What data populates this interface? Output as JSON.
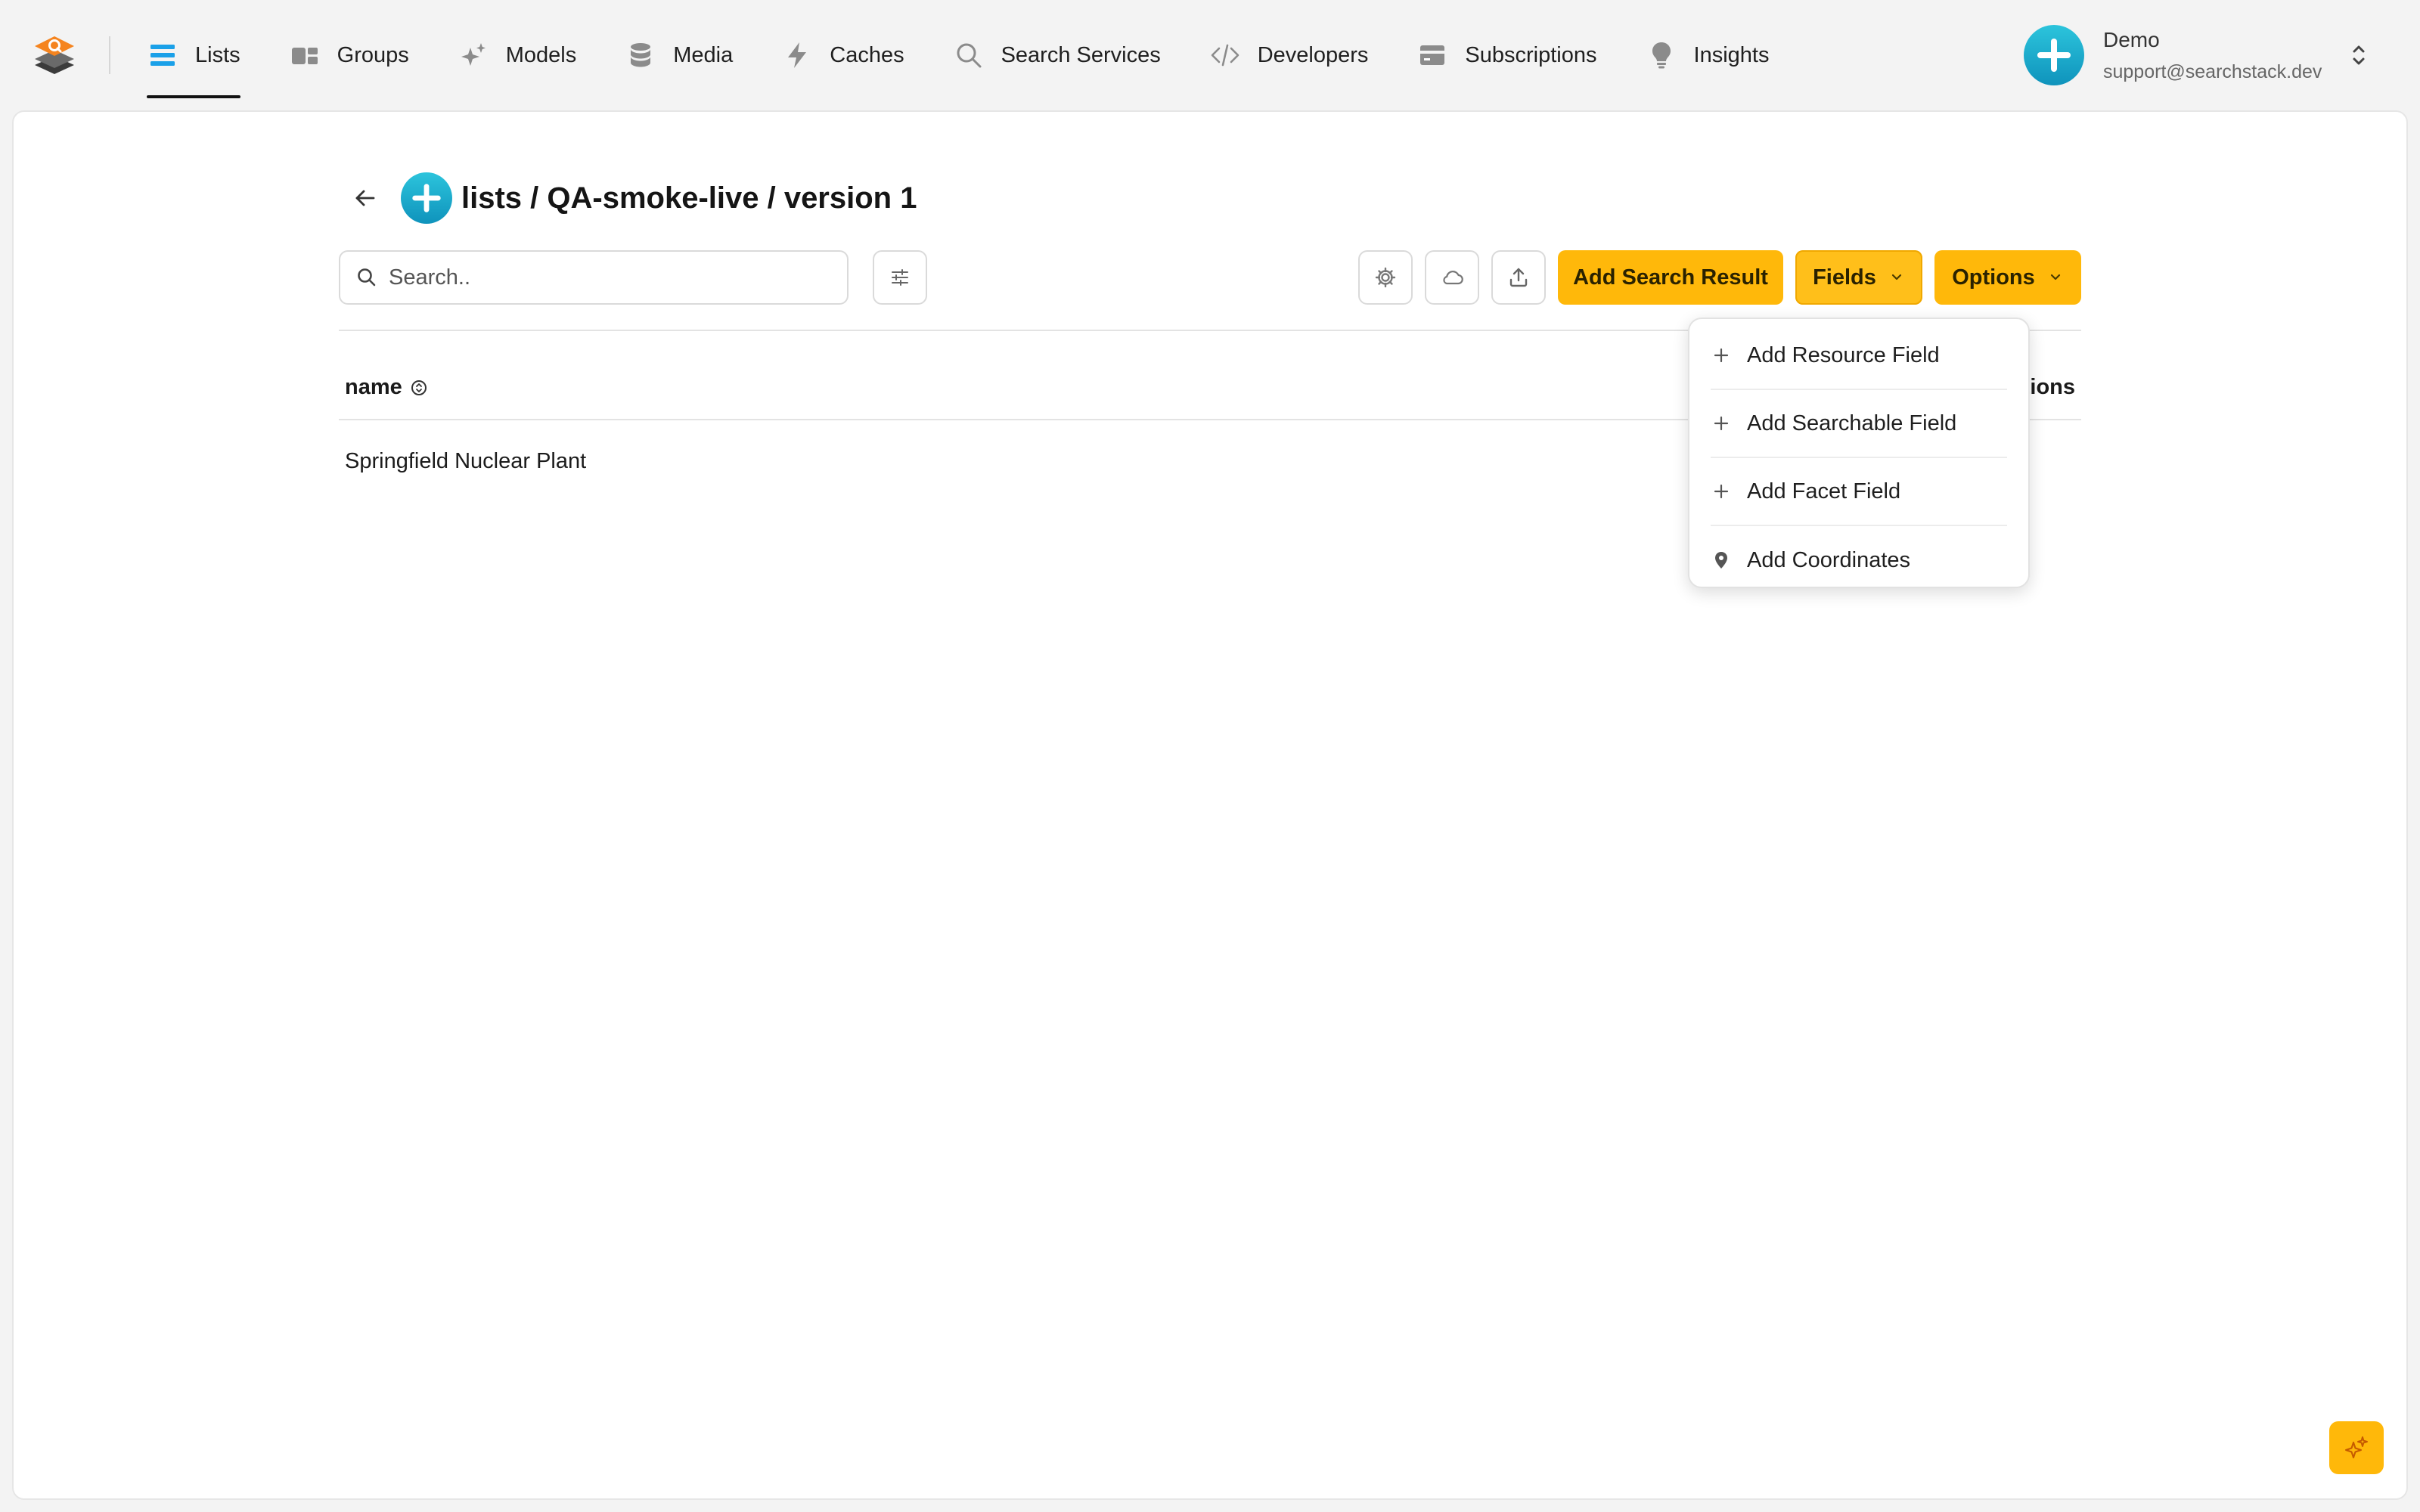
{
  "nav": {
    "items": [
      {
        "label": "Lists",
        "icon": "list-icon",
        "active": true
      },
      {
        "label": "Groups",
        "icon": "groups-icon"
      },
      {
        "label": "Models",
        "icon": "sparkles-icon"
      },
      {
        "label": "Media",
        "icon": "database-icon"
      },
      {
        "label": "Caches",
        "icon": "bolt-icon"
      },
      {
        "label": "Search Services",
        "icon": "search-icon"
      },
      {
        "label": "Developers",
        "icon": "code-icon"
      },
      {
        "label": "Subscriptions",
        "icon": "credit-card-icon"
      },
      {
        "label": "Insights",
        "icon": "lightbulb-icon"
      }
    ]
  },
  "user": {
    "name": "Demo",
    "email": "support@searchstack.dev"
  },
  "header": {
    "title": "lists / QA-smoke-live / version 1"
  },
  "toolbar": {
    "search_placeholder": "Search..",
    "add_search_result_label": "Add Search Result",
    "fields_label": "Fields",
    "options_label": "Options"
  },
  "table": {
    "columns": [
      "name",
      "actions"
    ],
    "rows": [
      {
        "name": "Springfield Nuclear Plant"
      }
    ]
  },
  "fields_menu": {
    "items": [
      {
        "label": "Add Resource Field",
        "icon": "plus-icon"
      },
      {
        "label": "Add Searchable Field",
        "icon": "plus-icon"
      },
      {
        "label": "Add Facet Field",
        "icon": "plus-icon"
      },
      {
        "label": "Add Coordinates",
        "icon": "map-pin-icon"
      }
    ]
  },
  "colors": {
    "accent_yellow": "#ffb80a",
    "active_nav_icon": "#1aa0e8",
    "brand_orange": "#f5841f",
    "avatar_teal": "#13a8c9"
  }
}
